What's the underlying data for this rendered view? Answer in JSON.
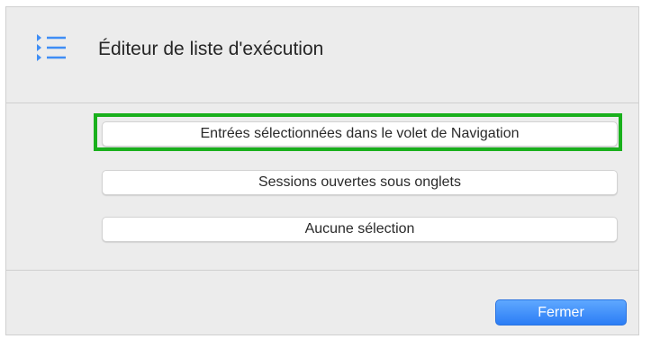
{
  "dialog": {
    "title": "Éditeur de liste d'exécution",
    "icon": "list-icon",
    "accent_color": "#3f8ef5",
    "highlight_color": "#19b01c"
  },
  "options": [
    {
      "label": "Entrées sélectionnées dans le volet de Navigation",
      "highlighted": true
    },
    {
      "label": "Sessions ouvertes sous onglets",
      "highlighted": false
    },
    {
      "label": "Aucune sélection",
      "highlighted": false
    }
  ],
  "footer": {
    "close_label": "Fermer"
  }
}
